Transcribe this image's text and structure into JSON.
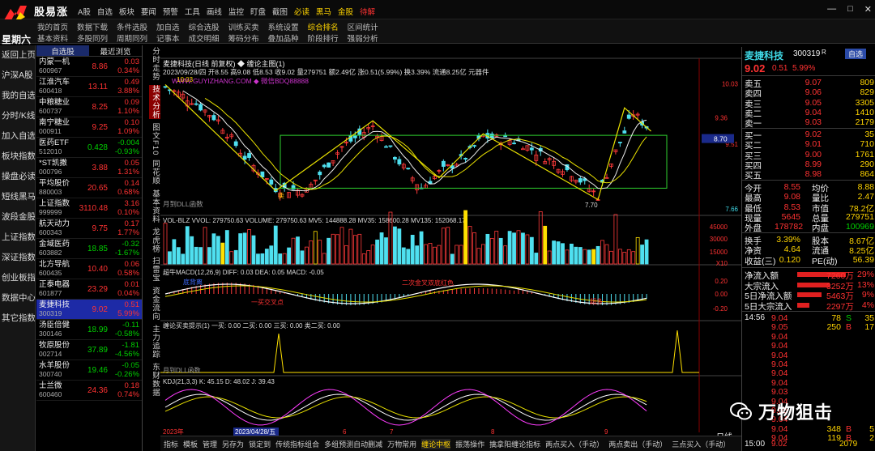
{
  "app": {
    "title": "股易涨",
    "weekday": "星期六",
    "top_menu": [
      "A股",
      "自选",
      "板块",
      "要闻",
      "预警",
      "工具",
      "画线",
      "监控",
      "盯盘",
      "截图",
      "必读",
      "黑马",
      "金股",
      "待解"
    ],
    "menu2_row1": [
      "我的首页",
      "数据下载",
      "条件选股",
      "加自选",
      "综合选股",
      "训练买卖",
      "系统设置",
      "综合排名",
      "区间统计"
    ],
    "menu2_row2": [
      "基本资料",
      "多股同列",
      "周期同列",
      "记事本",
      "成交明细",
      "筹码分布",
      "叠加品种",
      "阶段排行",
      "强弱分析"
    ],
    "window_buttons": [
      "—",
      "□",
      "✕"
    ]
  },
  "left_nav": [
    "返回上页",
    "沪深A股",
    "我的自选",
    "分时/K线",
    "加入自选",
    "板块指数",
    "操盘必读",
    "短线黑马",
    "波段金股",
    "上证指数",
    "深证指数",
    "创业板指",
    "数据中心",
    "其它指数"
  ],
  "stock_list": {
    "tabs": [
      "自选股",
      "最近浏览"
    ],
    "rows": [
      {
        "name": "内蒙一机",
        "code": "600967",
        "price": "8.86",
        "chg": "0.03",
        "pct": "0.34%",
        "dir": "up"
      },
      {
        "name": "江淮汽车",
        "code": "600418",
        "price": "13.11",
        "chg": "0.49",
        "pct": "3.88%",
        "dir": "up"
      },
      {
        "name": "中粮糖业",
        "code": "600737",
        "price": "8.25",
        "chg": "0.09",
        "pct": "1.10%",
        "dir": "up"
      },
      {
        "name": "南宁糖业",
        "code": "000911",
        "price": "9.25",
        "chg": "0.10",
        "pct": "1.09%",
        "dir": "up"
      },
      {
        "name": "医药ETF",
        "code": "512010",
        "price": "0.428",
        "chg": "-0.004",
        "pct": "-0.93%",
        "dir": "down"
      },
      {
        "name": "*ST凯撒",
        "code": "000796",
        "price": "3.88",
        "chg": "0.05",
        "pct": "1.31%",
        "dir": "up"
      },
      {
        "name": "平均股价",
        "code": "880003",
        "price": "20.65",
        "chg": "0.14",
        "pct": "0.68%",
        "dir": "up"
      },
      {
        "name": "上证指数",
        "code": "999999",
        "price": "3110.48",
        "chg": "3.16",
        "pct": "0.10%",
        "dir": "up"
      },
      {
        "name": "航天动力",
        "code": "600343",
        "price": "9.75",
        "chg": "0.17",
        "pct": "1.77%",
        "dir": "up"
      },
      {
        "name": "金域医药",
        "code": "603882",
        "price": "18.85",
        "chg": "-0.32",
        "pct": "-1.67%",
        "dir": "down"
      },
      {
        "name": "北方导航",
        "code": "600435",
        "price": "10.40",
        "chg": "0.06",
        "pct": "0.58%",
        "dir": "up"
      },
      {
        "name": "正泰电器",
        "code": "601877",
        "price": "23.29",
        "chg": "0.01",
        "pct": "0.04%",
        "dir": "up"
      },
      {
        "name": "麦捷科技",
        "code": "300319",
        "price": "9.02",
        "chg": "0.51",
        "pct": "5.99%",
        "dir": "up",
        "sel": true
      },
      {
        "name": "汤臣倍健",
        "code": "300146",
        "price": "18.99",
        "chg": "-0.11",
        "pct": "-0.58%",
        "dir": "down"
      },
      {
        "name": "牧原股份",
        "code": "002714",
        "price": "37.89",
        "chg": "-1.81",
        "pct": "-4.56%",
        "dir": "down"
      },
      {
        "name": "水羊股份",
        "code": "300740",
        "price": "19.46",
        "chg": "-0.05",
        "pct": "-0.26%",
        "dir": "down"
      },
      {
        "name": "士兰微",
        "code": "600460",
        "price": "24.36",
        "chg": "0.18",
        "pct": "0.74%",
        "dir": "up"
      }
    ]
  },
  "vertical_tabs": [
    "分时走势",
    "技术分析",
    "图文F10",
    "同花顺",
    "基本资料",
    "龙虎榜",
    "扫雷宝",
    "资金流向",
    "主力追踪",
    "东财数据"
  ],
  "chart_toolbar": {
    "periods": [
      "分时",
      "1分钟",
      "5分钟",
      "15分钟",
      "30分钟",
      "60分钟",
      "日线",
      "周线",
      "月线",
      "多周期",
      "更多 ▷"
    ],
    "active": "日线",
    "right": [
      "复权",
      "叠加",
      "统计",
      "画线",
      "F10",
      "标记",
      "+自选",
      "返回"
    ]
  },
  "chart_data": {
    "type": "candlestick",
    "title": "麦捷科技(日线 前复权) ◆ 缠论主图(1)",
    "info": "2023/09/28/四 开8.55 高9.08 低8.53 收9.02 量279751 额2.49亿 涨0.51(5.99%) 换3.39% 流通8.25亿 元器件",
    "watermark_text": "WWW.GUYIZHANG.COM ◆ 微信BDQ88888",
    "hint": "月到DLL函数",
    "price_labels": [
      "9.36",
      "9.51",
      "7.66",
      "10.03"
    ],
    "price_marker": "8.70",
    "high_label": "10.03",
    "low_label": "7.70",
    "buy_mark": "卖",
    "vol_axis": [
      "45000",
      "30000",
      "15000",
      "X10"
    ],
    "volume_info": "VOL-BLZ VVOL: 279750.63 VOLUME: 279750.63 MV5: 144888.28 MV35: 158600.28 MV135: 152068.17",
    "macd_info": "超牛MACD(12,26,9) DIFF: 0.03 DEA: 0.05 MACD: -0.05",
    "macd_axis": [
      "0.20",
      "0.00",
      "-0.20"
    ],
    "macd_marks": [
      "底背离",
      "一买交叉点",
      "二次金叉双底红色",
      "超多"
    ],
    "signal_info": "缠论买卖提示(1) 一买: 0.00 二买: 0.00 三买: 0.00 类二买: 0.00",
    "kdj_info": "KDJ(21,3,3) K: 45.15 D: 48.02 J: 39.43",
    "dates": [
      "2023年",
      "2023/04/28/五",
      "6",
      "7",
      "8",
      "9"
    ]
  },
  "quote": {
    "name": "麦捷科技",
    "code": "300319",
    "flag": "R",
    "tab": "自选",
    "price": "9.02",
    "chg": "0.51",
    "pct": "5.99%",
    "asks": [
      {
        "l": "卖五",
        "p": "9.07",
        "v": "809"
      },
      {
        "l": "卖四",
        "p": "9.06",
        "v": "829"
      },
      {
        "l": "卖三",
        "p": "9.05",
        "v": "3305"
      },
      {
        "l": "卖二",
        "p": "9.04",
        "v": "1410"
      },
      {
        "l": "卖一",
        "p": "9.03",
        "v": "2179"
      }
    ],
    "bids": [
      {
        "l": "买一",
        "p": "9.02",
        "v": "35"
      },
      {
        "l": "买二",
        "p": "9.01",
        "v": "710"
      },
      {
        "l": "买三",
        "p": "9.00",
        "v": "1761"
      },
      {
        "l": "买四",
        "p": "8.99",
        "v": "290"
      },
      {
        "l": "买五",
        "p": "8.98",
        "v": "864"
      }
    ],
    "stats": [
      [
        "今开",
        "8.55",
        "均价",
        "8.88"
      ],
      [
        "最高",
        "9.08",
        "量比",
        "2.47"
      ],
      [
        "最低",
        "8.53",
        "市值",
        "78.2亿"
      ],
      [
        "现量",
        "5645",
        "总量",
        "279751"
      ],
      [
        "外盘",
        "178782",
        "内盘",
        "100969"
      ]
    ],
    "stats2": [
      [
        "换手",
        "3.39%",
        "股本",
        "8.67亿"
      ],
      [
        "净资",
        "4.64",
        "流通",
        "8.25亿"
      ],
      [
        "收益(三)",
        "0.120",
        "PE(动)",
        "56.39"
      ]
    ],
    "flows": [
      [
        "净流入额",
        "7260万",
        "29%"
      ],
      [
        "大宗流入",
        "3252万",
        "13%"
      ],
      [
        "5日净流入额",
        "5463万",
        "9%"
      ],
      [
        "5日大宗流入",
        "2297万",
        "4%"
      ]
    ],
    "ticks_time": "14:56",
    "ticks": [
      [
        "9.04",
        "78",
        "S",
        "35"
      ],
      [
        "9.05",
        "250",
        "B",
        "17"
      ],
      [
        "9.04",
        "",
        "",
        ""
      ],
      [
        "9.04",
        "",
        "",
        ""
      ],
      [
        "9.04",
        "",
        "",
        ""
      ],
      [
        "9.04",
        "",
        "",
        ""
      ],
      [
        "9.04",
        "",
        "",
        ""
      ],
      [
        "9.04",
        "",
        "",
        ""
      ],
      [
        "9.03",
        "",
        "",
        ""
      ],
      [
        "9.04",
        "",
        "",
        ""
      ],
      [
        "9.05",
        "",
        "",
        ""
      ],
      [
        "9.04",
        "",
        "",
        ""
      ],
      [
        "9.04",
        "348",
        "B",
        "5"
      ],
      [
        "9.04",
        "119",
        "B",
        "2"
      ]
    ],
    "last_time": "15:00",
    "last_price": "9.02",
    "last_vol": "2079",
    "bottom_label": "日线"
  },
  "bottom_tabs": [
    "指标",
    "模板",
    "管理",
    "另存为",
    "锁定到",
    "传统指标组合",
    "多组预测自动删减",
    "万物常用",
    "缠论中枢",
    "振荡操作",
    "擒拿阳缠论指标",
    "两点买入（手动）",
    "两点卖出（手动）",
    "三点买入（手动）"
  ],
  "bottom_active": "缠论中枢",
  "watermark": "万物狙击"
}
